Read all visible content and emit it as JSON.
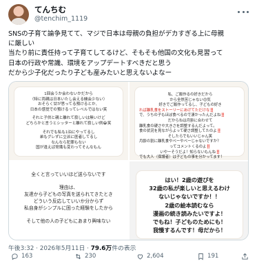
{
  "author": {
    "name": "てんちむ",
    "handle": "@tenchim_1119"
  },
  "tweet": {
    "lines": [
      "SNSの子育て論争見てて、マジで日本は母親の負担がデカすぎる上に母親",
      "に厳しい",
      "当たり前に責任持って子育てしてるけど、そもそも他国の文化も見習って",
      "日本の行政や常識、環境をアップデートすべきだと思う",
      "だから少子化だったり子ども産みたいと思えないよなー"
    ]
  },
  "media": {
    "top_left": [
      "1回会うか会わないかだから",
      "（特に両親は日本いたし会える機会少ない）",
      "おそらく甘が思ってる預けるとか、",
      "日本の感覚での預けるってレベルではない笑",
      "",
      "それと子供と親と離れて寂しいは無いけど",
      "どちらかと言うとシッターと離れて寂しい例😂笑",
      "",
      "それでも私も1泊にやってるし",
      "弟もグレずに立派に医者してるし",
      "なんなら犯罪もない",
      "国が違えば常識も変わってそんなもん"
    ],
    "top_right": [
      {
        "t": "私、ご飯作るの好きだから",
        "c": true
      },
      {
        "t": "から全然苦じゃない😊気",
        "c": true
      },
      {
        "t": "好きでご飯作ってるし、子どもの好き",
        "c": true
      },
      {
        "t": "れば離乳食をストーリーにあげてただけな‼️",
        "c": false,
        "red": true
      },
      {
        "t": "で、うちの子もほぼ食べるので凄かったんだよね‼️",
        "c": false
      },
      {
        "t": "だからねは月齢に合わせて",
        "c": true
      },
      {
        "t": "離乳食の硬さや大きさを調整するんだよって。",
        "c": false
      },
      {
        "t": "食の状況を見ながらよって硬さ調整してたのよ‼️",
        "c": false
      },
      {
        "t": "そしたらでもいいじゃん笑",
        "c": true
      },
      {
        "t": "月齢の割に離乳食やべーやべーじゃないですか？",
        "c": false
      },
      {
        "t": "ってコメントくるのよ‼️",
        "c": true
      },
      {
        "t": "いやーそうだよ！知らないもんね‼️",
        "c": true
      },
      {
        "t": "でも大人（保護者）は子どもの事を分かってます！",
        "c": false
      },
      {
        "t": "離乳食や幼児食をストーリーに載せるのやめた笑",
        "c": false
      }
    ],
    "bottom_left": [
      "全くと言っていいほど送らないです",
      "",
      "理由は、",
      "友達から子どもの写真を送られてきたとき",
      "どういう反応していいか分からず",
      "私自身がシンプルに困った経験をしたから",
      "",
      "そして他の人の子どもにあまり興味ない"
    ],
    "bottom_right": [
      "はい！2歳の遊びを",
      "32歳の私が楽しいと思えるわけ",
      "ないじゃないですか！！",
      "2歳の絵本読むなら",
      "漫画の続き読みたいですよ！",
      "でもね！子どものためにも！",
      "我慢するんです！母だから！"
    ]
  },
  "meta": {
    "time": "午後3:32",
    "date": "2026年5月11日",
    "separator": "·",
    "views_count": "79.6万",
    "views_label": "件の表示"
  },
  "actions": {
    "reply_count": "163",
    "retweet_count": "230",
    "like_count": "2,604",
    "bookmark_count": "191"
  }
}
